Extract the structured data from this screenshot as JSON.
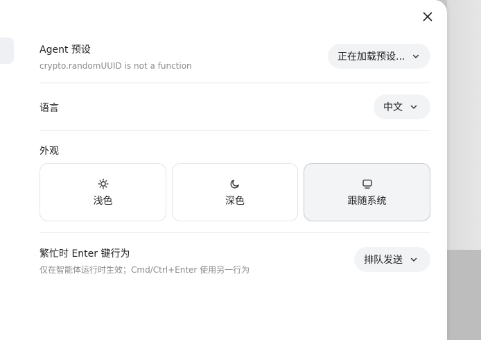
{
  "agent_preset": {
    "title": "Agent 预设",
    "error": "crypto.randomUUID is not a function",
    "dropdown_value": "正在加载预设..."
  },
  "language": {
    "title": "语言",
    "dropdown_value": "中文"
  },
  "appearance": {
    "title": "外观",
    "options": [
      {
        "label": "浅色",
        "icon": "sun-icon"
      },
      {
        "label": "深色",
        "icon": "moon-icon"
      },
      {
        "label": "跟随系统",
        "icon": "monitor-icon"
      }
    ],
    "selected": "跟随系统"
  },
  "busy_enter": {
    "title": "繁忙时 Enter 键行为",
    "hint": "仅在智能体运行时生效；Cmd/Ctrl+Enter 使用另一行为",
    "dropdown_value": "排队发送"
  },
  "icons": {
    "close": "close-icon",
    "chevron": "chevron-down-icon"
  }
}
